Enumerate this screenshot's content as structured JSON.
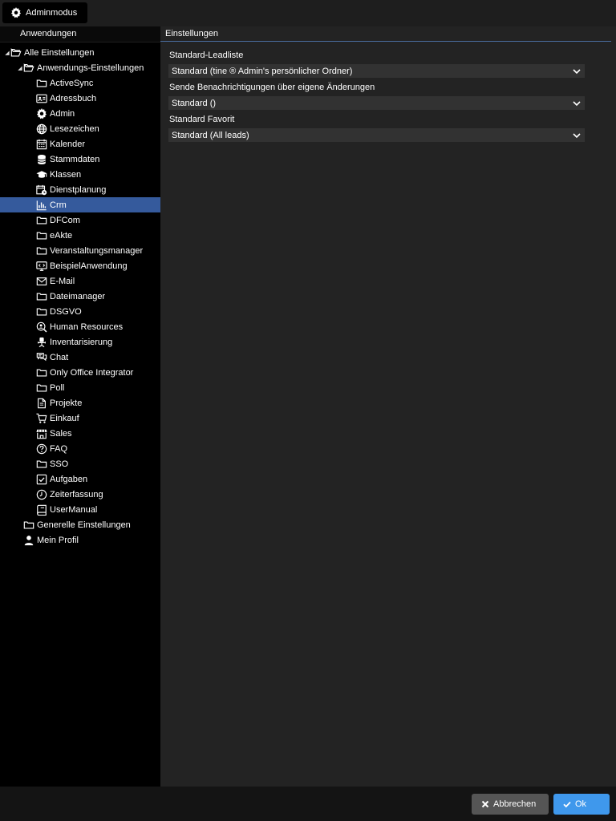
{
  "toolbar": {
    "admin_label": "Adminmodus"
  },
  "sidebar": {
    "header": "Anwendungen",
    "tree": [
      {
        "label": "Alle Einstellungen",
        "icon": "folder-open-icon",
        "level": 0,
        "expanded": true
      },
      {
        "label": "Anwendungs-Einstellungen",
        "icon": "folder-open-icon",
        "level": 1,
        "expanded": true
      },
      {
        "label": "ActiveSync",
        "icon": "folder-icon",
        "level": 2
      },
      {
        "label": "Adressbuch",
        "icon": "address-card-icon",
        "level": 2
      },
      {
        "label": "Admin",
        "icon": "gear-icon",
        "level": 2
      },
      {
        "label": "Lesezeichen",
        "icon": "globe-icon",
        "level": 2
      },
      {
        "label": "Kalender",
        "icon": "calendar-icon",
        "level": 2
      },
      {
        "label": "Stammdaten",
        "icon": "database-icon",
        "level": 2
      },
      {
        "label": "Klassen",
        "icon": "graduation-cap-icon",
        "level": 2
      },
      {
        "label": "Dienstplanung",
        "icon": "calendar-clock-icon",
        "level": 2
      },
      {
        "label": "Crm",
        "icon": "bar-chart-icon",
        "level": 2,
        "selected": true
      },
      {
        "label": "DFCom",
        "icon": "folder-icon",
        "level": 2
      },
      {
        "label": "eAkte",
        "icon": "folder-icon",
        "level": 2
      },
      {
        "label": "Veranstaltungsmanager",
        "icon": "folder-icon",
        "level": 2
      },
      {
        "label": "BeispielAnwendung",
        "icon": "monitor-code-icon",
        "level": 2
      },
      {
        "label": "E-Mail",
        "icon": "envelope-icon",
        "level": 2
      },
      {
        "label": "Dateimanager",
        "icon": "folder-icon",
        "level": 2
      },
      {
        "label": "DSGVO",
        "icon": "folder-icon",
        "level": 2
      },
      {
        "label": "Human Resources",
        "icon": "user-search-icon",
        "level": 2
      },
      {
        "label": "Inventarisierung",
        "icon": "office-chair-icon",
        "level": 2
      },
      {
        "label": "Chat",
        "icon": "chat-icon",
        "level": 2
      },
      {
        "label": "Only Office Integrator",
        "icon": "folder-icon",
        "level": 2
      },
      {
        "label": "Poll",
        "icon": "folder-icon",
        "level": 2
      },
      {
        "label": "Projekte",
        "icon": "document-icon",
        "level": 2
      },
      {
        "label": "Einkauf",
        "icon": "cart-icon",
        "level": 2
      },
      {
        "label": "Sales",
        "icon": "store-icon",
        "level": 2
      },
      {
        "label": "FAQ",
        "icon": "question-circle-icon",
        "level": 2
      },
      {
        "label": "SSO",
        "icon": "folder-icon",
        "level": 2
      },
      {
        "label": "Aufgaben",
        "icon": "checkbox-icon",
        "level": 2
      },
      {
        "label": "Zeiterfassung",
        "icon": "clock-icon",
        "level": 2
      },
      {
        "label": "UserManual",
        "icon": "book-icon",
        "level": 2
      },
      {
        "label": "Generelle Einstellungen",
        "icon": "folder-icon",
        "level": 1
      },
      {
        "label": "Mein Profil",
        "icon": "user-icon",
        "level": 1
      }
    ]
  },
  "main": {
    "header": "Einstellungen",
    "fields": [
      {
        "label": "Standard-Leadliste",
        "value": "Standard (tine ® Admin's persönlicher Ordner)"
      },
      {
        "label": "Sende Benachrichtigungen über eigene Änderungen",
        "value": "Standard ()"
      },
      {
        "label": "Standard Favorit",
        "value": "Standard (All leads)"
      }
    ]
  },
  "footer": {
    "cancel_label": "Abbrechen",
    "ok_label": "Ok"
  }
}
